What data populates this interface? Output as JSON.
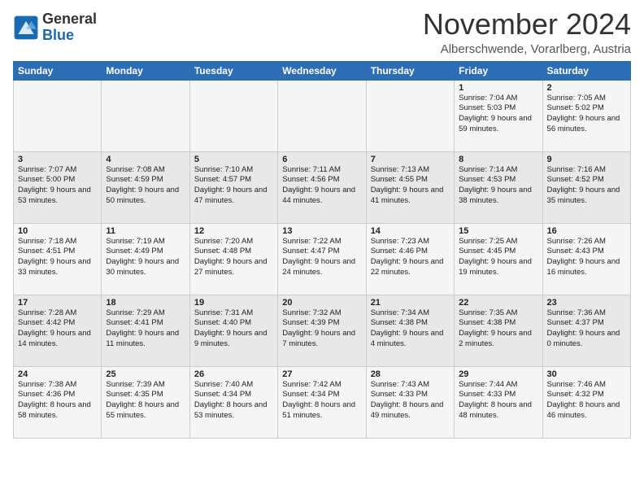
{
  "header": {
    "logo_general": "General",
    "logo_blue": "Blue",
    "month": "November 2024",
    "location": "Alberschwende, Vorarlberg, Austria"
  },
  "weekdays": [
    "Sunday",
    "Monday",
    "Tuesday",
    "Wednesday",
    "Thursday",
    "Friday",
    "Saturday"
  ],
  "weeks": [
    [
      {
        "day": "",
        "info": ""
      },
      {
        "day": "",
        "info": ""
      },
      {
        "day": "",
        "info": ""
      },
      {
        "day": "",
        "info": ""
      },
      {
        "day": "",
        "info": ""
      },
      {
        "day": "1",
        "info": "Sunrise: 7:04 AM\nSunset: 5:03 PM\nDaylight: 9 hours\nand 59 minutes."
      },
      {
        "day": "2",
        "info": "Sunrise: 7:05 AM\nSunset: 5:02 PM\nDaylight: 9 hours\nand 56 minutes."
      }
    ],
    [
      {
        "day": "3",
        "info": "Sunrise: 7:07 AM\nSunset: 5:00 PM\nDaylight: 9 hours\nand 53 minutes."
      },
      {
        "day": "4",
        "info": "Sunrise: 7:08 AM\nSunset: 4:59 PM\nDaylight: 9 hours\nand 50 minutes."
      },
      {
        "day": "5",
        "info": "Sunrise: 7:10 AM\nSunset: 4:57 PM\nDaylight: 9 hours\nand 47 minutes."
      },
      {
        "day": "6",
        "info": "Sunrise: 7:11 AM\nSunset: 4:56 PM\nDaylight: 9 hours\nand 44 minutes."
      },
      {
        "day": "7",
        "info": "Sunrise: 7:13 AM\nSunset: 4:55 PM\nDaylight: 9 hours\nand 41 minutes."
      },
      {
        "day": "8",
        "info": "Sunrise: 7:14 AM\nSunset: 4:53 PM\nDaylight: 9 hours\nand 38 minutes."
      },
      {
        "day": "9",
        "info": "Sunrise: 7:16 AM\nSunset: 4:52 PM\nDaylight: 9 hours\nand 35 minutes."
      }
    ],
    [
      {
        "day": "10",
        "info": "Sunrise: 7:18 AM\nSunset: 4:51 PM\nDaylight: 9 hours\nand 33 minutes."
      },
      {
        "day": "11",
        "info": "Sunrise: 7:19 AM\nSunset: 4:49 PM\nDaylight: 9 hours\nand 30 minutes."
      },
      {
        "day": "12",
        "info": "Sunrise: 7:20 AM\nSunset: 4:48 PM\nDaylight: 9 hours\nand 27 minutes."
      },
      {
        "day": "13",
        "info": "Sunrise: 7:22 AM\nSunset: 4:47 PM\nDaylight: 9 hours\nand 24 minutes."
      },
      {
        "day": "14",
        "info": "Sunrise: 7:23 AM\nSunset: 4:46 PM\nDaylight: 9 hours\nand 22 minutes."
      },
      {
        "day": "15",
        "info": "Sunrise: 7:25 AM\nSunset: 4:45 PM\nDaylight: 9 hours\nand 19 minutes."
      },
      {
        "day": "16",
        "info": "Sunrise: 7:26 AM\nSunset: 4:43 PM\nDaylight: 9 hours\nand 16 minutes."
      }
    ],
    [
      {
        "day": "17",
        "info": "Sunrise: 7:28 AM\nSunset: 4:42 PM\nDaylight: 9 hours\nand 14 minutes."
      },
      {
        "day": "18",
        "info": "Sunrise: 7:29 AM\nSunset: 4:41 PM\nDaylight: 9 hours\nand 11 minutes."
      },
      {
        "day": "19",
        "info": "Sunrise: 7:31 AM\nSunset: 4:40 PM\nDaylight: 9 hours\nand 9 minutes."
      },
      {
        "day": "20",
        "info": "Sunrise: 7:32 AM\nSunset: 4:39 PM\nDaylight: 9 hours\nand 7 minutes."
      },
      {
        "day": "21",
        "info": "Sunrise: 7:34 AM\nSunset: 4:38 PM\nDaylight: 9 hours\nand 4 minutes."
      },
      {
        "day": "22",
        "info": "Sunrise: 7:35 AM\nSunset: 4:38 PM\nDaylight: 9 hours\nand 2 minutes."
      },
      {
        "day": "23",
        "info": "Sunrise: 7:36 AM\nSunset: 4:37 PM\nDaylight: 9 hours\nand 0 minutes."
      }
    ],
    [
      {
        "day": "24",
        "info": "Sunrise: 7:38 AM\nSunset: 4:36 PM\nDaylight: 8 hours\nand 58 minutes."
      },
      {
        "day": "25",
        "info": "Sunrise: 7:39 AM\nSunset: 4:35 PM\nDaylight: 8 hours\nand 55 minutes."
      },
      {
        "day": "26",
        "info": "Sunrise: 7:40 AM\nSunset: 4:34 PM\nDaylight: 8 hours\nand 53 minutes."
      },
      {
        "day": "27",
        "info": "Sunrise: 7:42 AM\nSunset: 4:34 PM\nDaylight: 8 hours\nand 51 minutes."
      },
      {
        "day": "28",
        "info": "Sunrise: 7:43 AM\nSunset: 4:33 PM\nDaylight: 8 hours\nand 49 minutes."
      },
      {
        "day": "29",
        "info": "Sunrise: 7:44 AM\nSunset: 4:33 PM\nDaylight: 8 hours\nand 48 minutes."
      },
      {
        "day": "30",
        "info": "Sunrise: 7:46 AM\nSunset: 4:32 PM\nDaylight: 8 hours\nand 46 minutes."
      }
    ]
  ]
}
